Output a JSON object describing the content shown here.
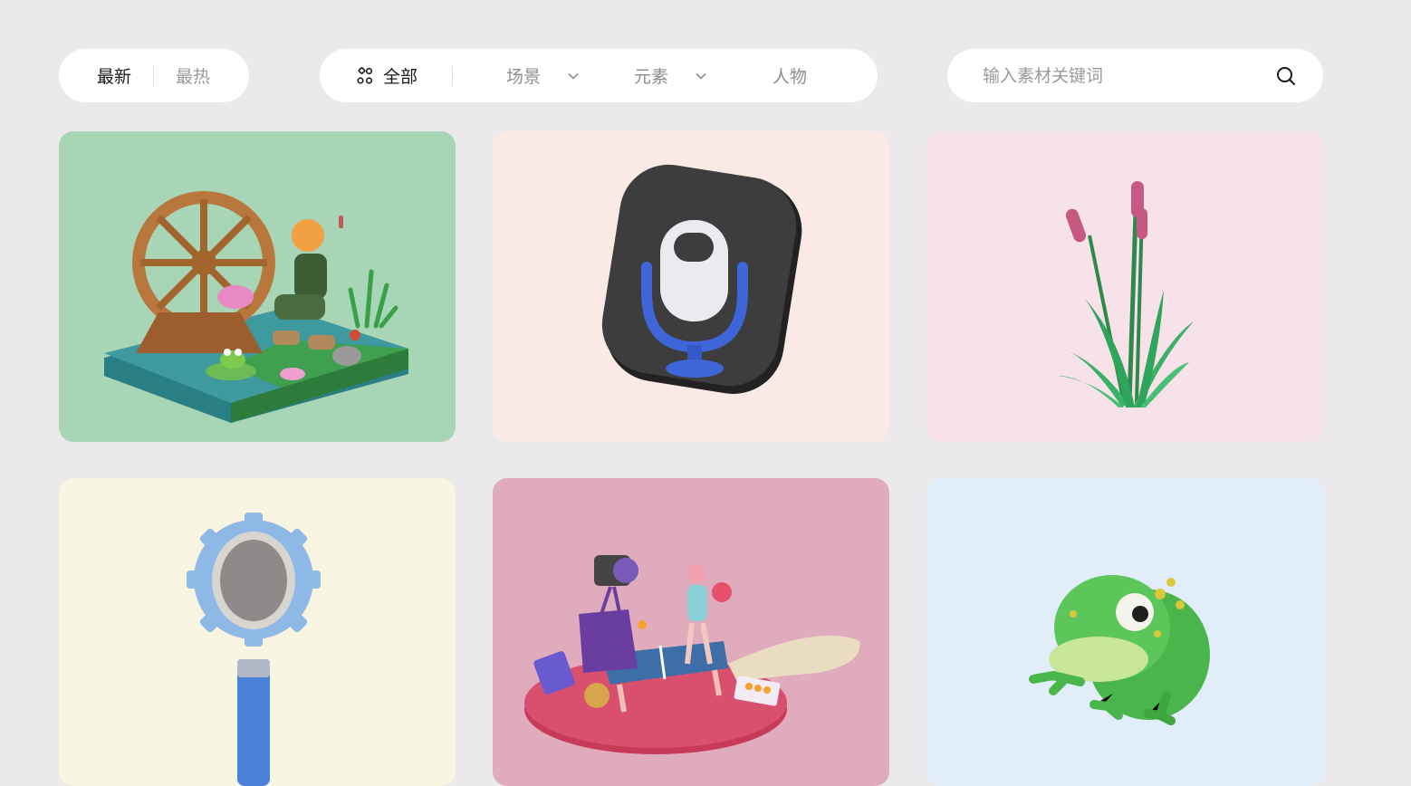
{
  "sort": {
    "latest": "最新",
    "hottest": "最热"
  },
  "filters": {
    "all": "全部",
    "scene": "场景",
    "element": "元素",
    "character": "人物"
  },
  "search": {
    "placeholder": "输入素材关键词"
  },
  "cards": [
    {
      "subject": "water-wheel-pond-boy-scene",
      "bg": "#a8d5b6"
    },
    {
      "subject": "microphone-app-icon",
      "bg": "#fae9e4"
    },
    {
      "subject": "cattail-reed-plant",
      "bg": "#f8e2ea"
    },
    {
      "subject": "gear-magnifier-icon",
      "bg": "#f8f5e3"
    },
    {
      "subject": "ping-pong-girl-scene",
      "bg": "#e0acbd"
    },
    {
      "subject": "green-frog",
      "bg": "#e1eefa"
    }
  ]
}
